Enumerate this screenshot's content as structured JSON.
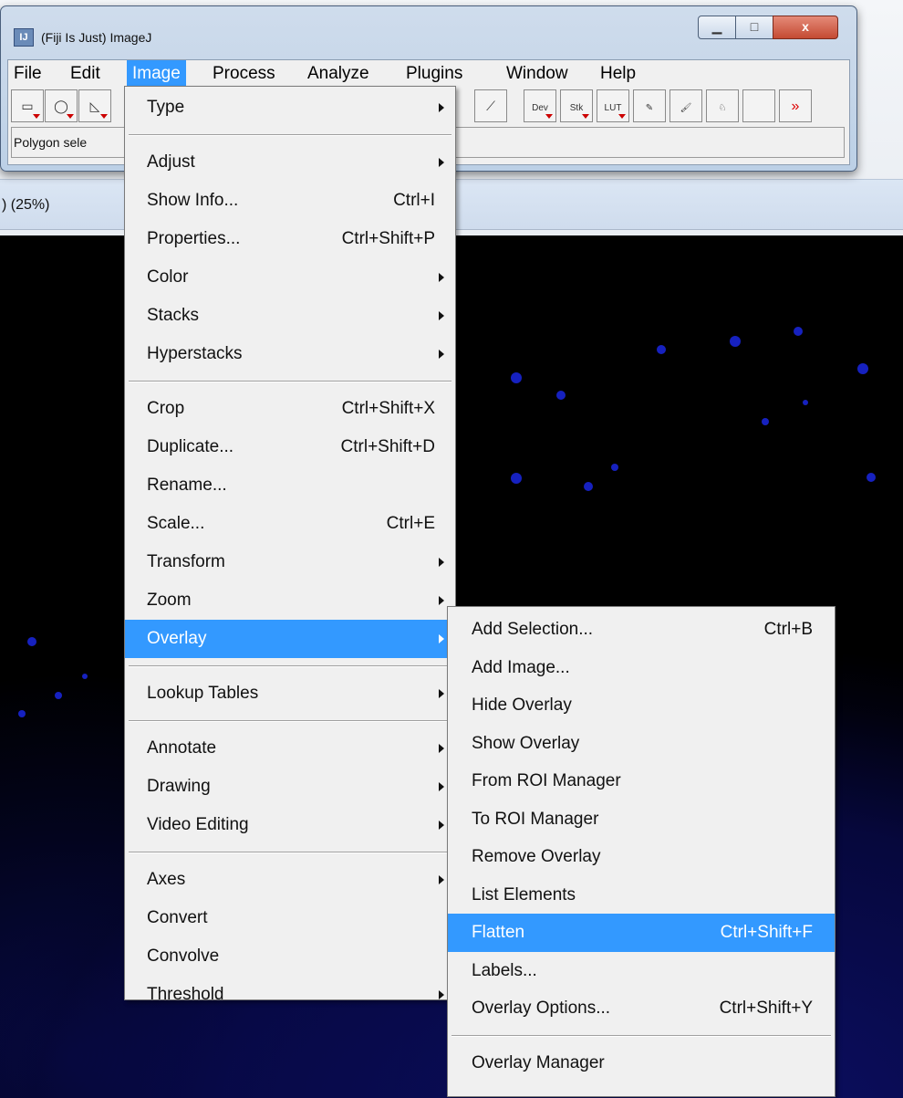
{
  "window": {
    "title": "(Fiji Is Just) ImageJ",
    "icon_text": "IJ"
  },
  "title_buttons": {
    "minimize": "▁",
    "maximize": "□",
    "close": "x"
  },
  "menubar": [
    "File",
    "Edit",
    "Image",
    "Process",
    "Analyze",
    "Plugins",
    "Window",
    "Help"
  ],
  "toolbar": {
    "tools": [
      "rectangle-tool",
      "oval-tool",
      "polygon-tool"
    ],
    "right_tools": [
      {
        "name": "dev-menu-tool",
        "label": "Dev"
      },
      {
        "name": "stk-menu-tool",
        "label": "Stk"
      },
      {
        "name": "lut-menu-tool",
        "label": "LUT"
      },
      {
        "name": "pencil-tool",
        "label": "✎"
      },
      {
        "name": "brush-tool",
        "label": "🖌"
      },
      {
        "name": "flood-fill-tool",
        "label": "♘"
      },
      {
        "name": "blank-tool",
        "label": ""
      },
      {
        "name": "more-tools-button",
        "label": "»"
      }
    ]
  },
  "status_line": "Polygon sele",
  "image_window": {
    "status": ") (25%)"
  },
  "image_menu": {
    "items": [
      {
        "label": "Type",
        "submenu": true
      },
      {
        "separator": true
      },
      {
        "label": "Adjust",
        "submenu": true
      },
      {
        "label": "Show Info...",
        "shortcut": "Ctrl+I"
      },
      {
        "label": "Properties...",
        "shortcut": "Ctrl+Shift+P"
      },
      {
        "label": "Color",
        "submenu": true
      },
      {
        "label": "Stacks",
        "submenu": true
      },
      {
        "label": "Hyperstacks",
        "submenu": true
      },
      {
        "separator": true
      },
      {
        "label": "Crop",
        "shortcut": "Ctrl+Shift+X"
      },
      {
        "label": "Duplicate...",
        "shortcut": "Ctrl+Shift+D"
      },
      {
        "label": "Rename..."
      },
      {
        "label": "Scale...",
        "shortcut": "Ctrl+E"
      },
      {
        "label": "Transform",
        "submenu": true
      },
      {
        "label": "Zoom",
        "submenu": true
      },
      {
        "label": "Overlay",
        "submenu": true,
        "highlighted": true
      },
      {
        "separator": true
      },
      {
        "label": "Lookup Tables",
        "submenu": true
      },
      {
        "separator": true
      },
      {
        "label": "Annotate",
        "submenu": true
      },
      {
        "label": "Drawing",
        "submenu": true
      },
      {
        "label": "Video Editing",
        "submenu": true
      },
      {
        "separator": true
      },
      {
        "label": "Axes",
        "submenu": true
      },
      {
        "label": "Convert"
      },
      {
        "label": "Convolve"
      },
      {
        "label": "Threshold",
        "submenu": true
      }
    ]
  },
  "overlay_menu": {
    "items": [
      {
        "label": "Add Selection...",
        "shortcut": "Ctrl+B"
      },
      {
        "label": "Add Image..."
      },
      {
        "label": "Hide Overlay"
      },
      {
        "label": "Show Overlay"
      },
      {
        "label": "From ROI Manager"
      },
      {
        "label": "To ROI Manager"
      },
      {
        "label": "Remove Overlay"
      },
      {
        "label": "List Elements"
      },
      {
        "label": "Flatten",
        "shortcut": "Ctrl+Shift+F",
        "highlighted": true
      },
      {
        "label": "Labels..."
      },
      {
        "label": "Overlay Options...",
        "shortcut": "Ctrl+Shift+Y"
      },
      {
        "separator": true
      },
      {
        "label": "Overlay Manager"
      }
    ]
  },
  "colors": {
    "highlight": "#3399ff",
    "menu_bg": "#f0f0f0",
    "image_fluor": "#1d2cff"
  }
}
